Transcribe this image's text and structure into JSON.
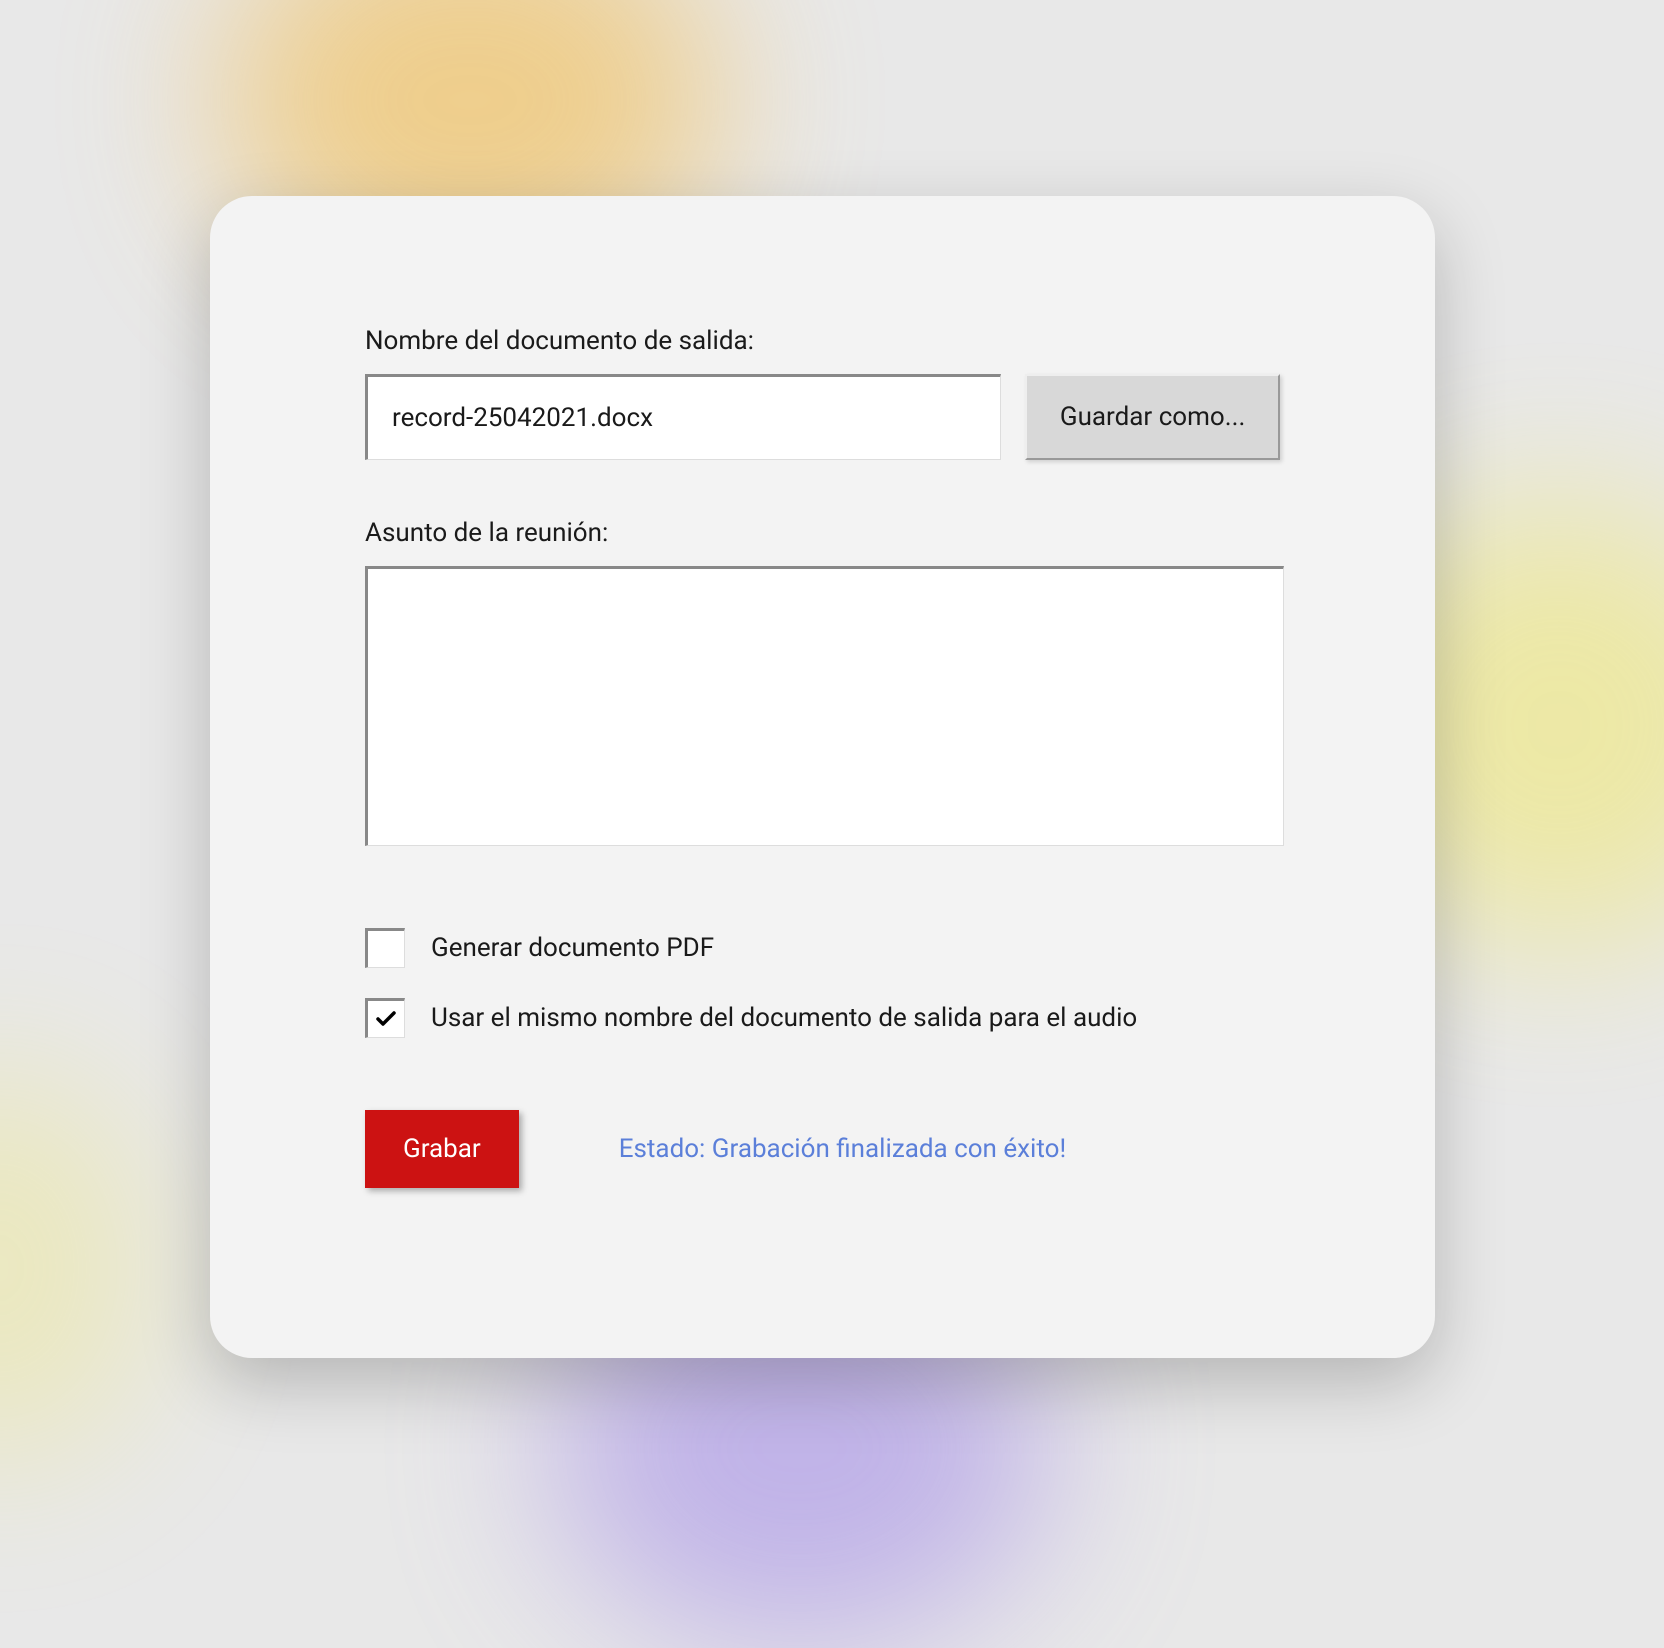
{
  "labels": {
    "output_document_name": "Nombre del documento de salida:",
    "meeting_subject": "Asunto de la reunión:"
  },
  "inputs": {
    "filename_value": "record-25042021.docx",
    "subject_value": ""
  },
  "buttons": {
    "save_as": "Guardar como...",
    "record": "Grabar"
  },
  "checkboxes": {
    "generate_pdf": {
      "label": "Generar  documento PDF",
      "checked": false
    },
    "same_name_audio": {
      "label": "Usar el mismo nombre del documento de salida  para el audio",
      "checked": true
    }
  },
  "status": {
    "text": "Estado: Grabación finalizada con éxito!"
  }
}
